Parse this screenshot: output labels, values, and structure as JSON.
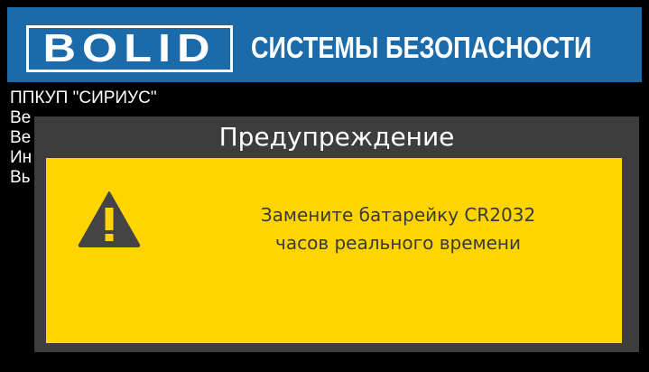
{
  "header": {
    "logo_text": "BOLID",
    "title": "СИСТЕМЫ БЕЗОПАСНОСТИ",
    "background_color": "#1b6aa9"
  },
  "background_text": {
    "lines": [
      "ППКУП \"СИРИУС\"",
      "Ве",
      "Ве",
      "Ин",
      "Вь"
    ]
  },
  "dialog": {
    "title": "Предупреждение",
    "icon": "warning-icon",
    "message_lines": [
      "Замените батарейку CR2032",
      "часов реального времени"
    ],
    "frame_color": "#3d3d3d",
    "body_color": "#ffd500"
  }
}
